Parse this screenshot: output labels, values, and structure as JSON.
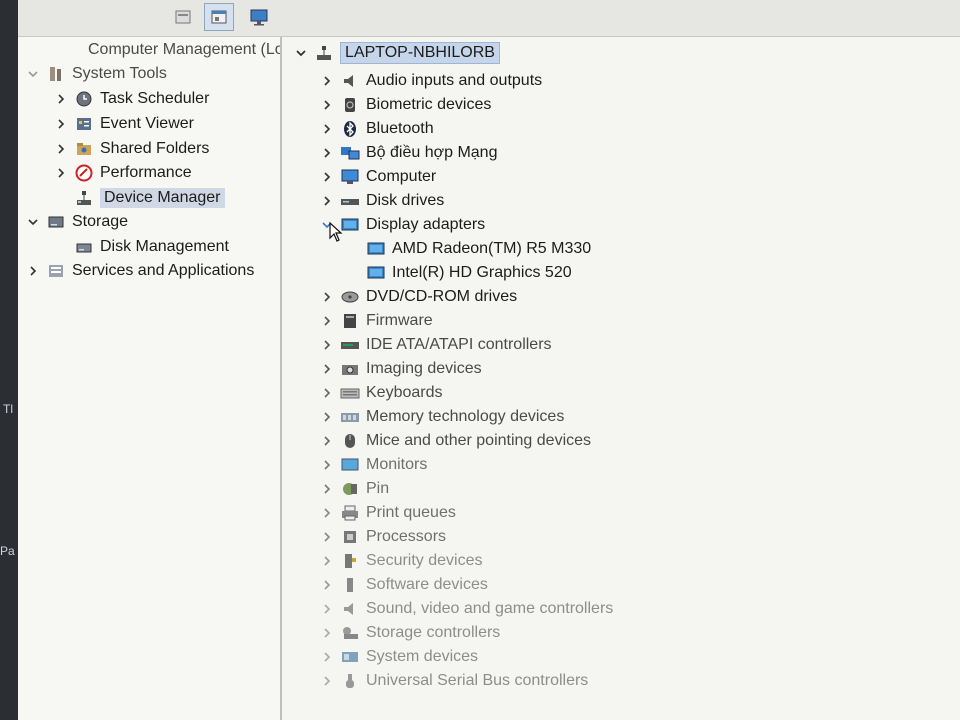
{
  "left_tree": {
    "root_label": "Computer Management (Local",
    "items": [
      {
        "label": "System Tools"
      },
      {
        "label": "Task Scheduler"
      },
      {
        "label": "Event Viewer"
      },
      {
        "label": "Shared Folders"
      },
      {
        "label": "Performance"
      },
      {
        "label": "Device Manager"
      },
      {
        "label": "Storage"
      },
      {
        "label": "Disk Management"
      },
      {
        "label": "Services and Applications"
      }
    ]
  },
  "device_tree": {
    "root_label": "LAPTOP-NBHILORB",
    "categories": [
      {
        "label": "Audio inputs and outputs",
        "icon": "speaker-icon"
      },
      {
        "label": "Biometric devices",
        "icon": "biometric-icon"
      },
      {
        "label": "Bluetooth",
        "icon": "bluetooth-icon"
      },
      {
        "label": "Bộ điều hợp Mạng",
        "icon": "network-adapter-icon"
      },
      {
        "label": "Computer",
        "icon": "computer-icon"
      },
      {
        "label": "Disk drives",
        "icon": "disk-drive-icon"
      },
      {
        "label": "Display adapters",
        "icon": "display-adapter-icon",
        "children": [
          {
            "label": "AMD Radeon(TM) R5 M330"
          },
          {
            "label": "Intel(R) HD Graphics 520"
          }
        ]
      },
      {
        "label": "DVD/CD-ROM drives",
        "icon": "dvd-drive-icon"
      },
      {
        "label": "Firmware",
        "icon": "firmware-icon"
      },
      {
        "label": "IDE ATA/ATAPI controllers",
        "icon": "ide-controller-icon"
      },
      {
        "label": "Imaging devices",
        "icon": "camera-icon"
      },
      {
        "label": "Keyboards",
        "icon": "keyboard-icon"
      },
      {
        "label": "Memory technology devices",
        "icon": "memory-icon"
      },
      {
        "label": "Mice and other pointing devices",
        "icon": "mouse-icon"
      },
      {
        "label": "Monitors",
        "icon": "monitor-icon"
      },
      {
        "label": "Pin",
        "icon": "battery-icon"
      },
      {
        "label": "Print queues",
        "icon": "printer-icon"
      },
      {
        "label": "Processors",
        "icon": "processor-icon"
      },
      {
        "label": "Security devices",
        "icon": "security-device-icon"
      },
      {
        "label": "Software devices",
        "icon": "software-device-icon"
      },
      {
        "label": "Sound, video and game controllers",
        "icon": "sound-controller-icon"
      },
      {
        "label": "Storage controllers",
        "icon": "storage-controller-icon"
      },
      {
        "label": "System devices",
        "icon": "system-device-icon"
      },
      {
        "label": "Universal Serial Bus controllers",
        "icon": "usb-icon"
      }
    ]
  },
  "desktop": {
    "edge_text_1": "Tl",
    "edge_text_2": "Pa"
  },
  "colors": {
    "selection": "#cfd8e4",
    "accent_blue": "#2a7fd4"
  }
}
